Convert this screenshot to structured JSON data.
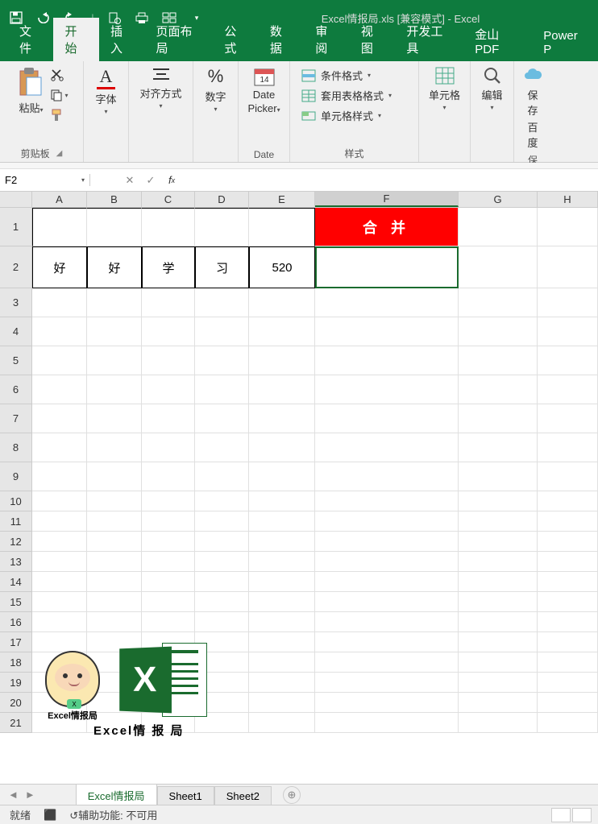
{
  "title": {
    "filename": "Excel情报局.xls",
    "mode": "[兼容模式]",
    "app": "Excel"
  },
  "tabs": [
    "文件",
    "开始",
    "插入",
    "页面布局",
    "公式",
    "数据",
    "审阅",
    "视图",
    "开发工具",
    "金山PDF",
    "Power P"
  ],
  "active_tab_index": 1,
  "ribbon": {
    "clipboard": {
      "paste": "粘贴",
      "label": "剪贴板"
    },
    "font": {
      "btn": "字体"
    },
    "align": {
      "btn": "对齐方式"
    },
    "number": {
      "btn": "数字",
      "symbol": "%"
    },
    "date": {
      "line1": "Date",
      "line2": "Picker",
      "label": "Date",
      "num": "14"
    },
    "styles": {
      "cond": "条件格式",
      "fmt_table": "套用表格格式",
      "cell_style": "单元格样式",
      "label": "样式"
    },
    "cells": {
      "btn": "单元格"
    },
    "edit": {
      "btn": "编辑"
    },
    "baidu": {
      "line1": "保存",
      "line2": "百度",
      "label": "保"
    }
  },
  "namebox": "F2",
  "formula": "",
  "columns": [
    "A",
    "B",
    "C",
    "D",
    "E",
    "F",
    "G",
    "H"
  ],
  "row_numbers": [
    1,
    2,
    3,
    4,
    5,
    6,
    7,
    8,
    9,
    10,
    11,
    12,
    13,
    14,
    15,
    16,
    17,
    18,
    19,
    20,
    21
  ],
  "cells": {
    "F1": "合 并",
    "A2": "好",
    "B2": "好",
    "C2": "学",
    "D2": "习",
    "E2": "520"
  },
  "overlay": {
    "label1": "Excel情报局",
    "label2": "Excel情 报 局"
  },
  "sheets": [
    "Excel情报局",
    "Sheet1",
    "Sheet2"
  ],
  "active_sheet_index": 0,
  "status": {
    "ready": "就绪",
    "acc_icon": "↺",
    "acc": "辅助功能: 不可用",
    "rec": "⬛"
  }
}
